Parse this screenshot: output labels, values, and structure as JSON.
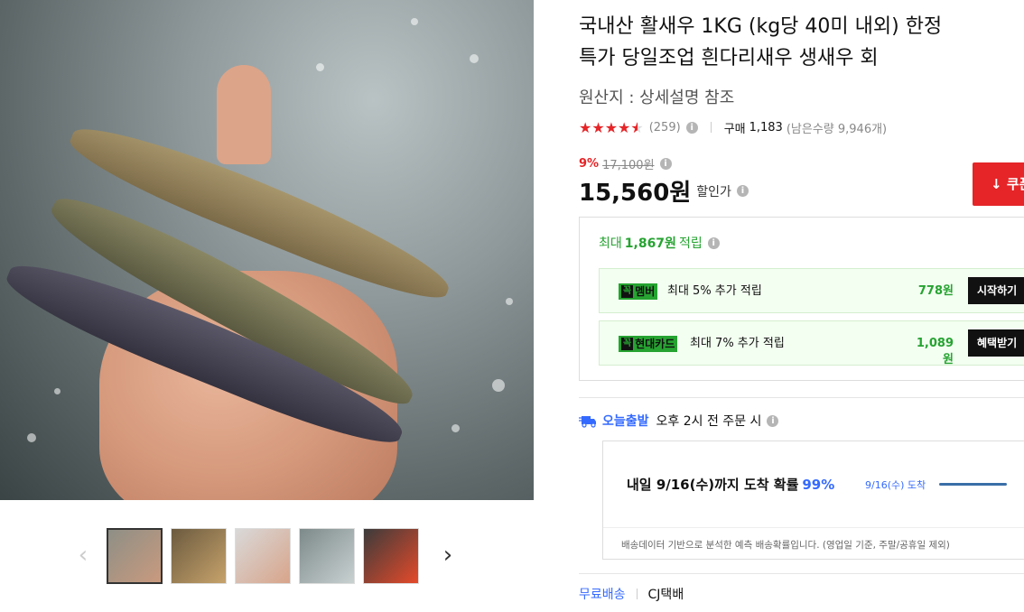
{
  "product": {
    "title_line1": "국내산 활새우 1KG (kg당 40미 내외) 한정",
    "title_line2": "특가 당일조업 흰다리새우 생새우 회",
    "origin": "원산지 : 상세설명 참조"
  },
  "rating": {
    "stars": 4.5,
    "count": "(259)",
    "purchase_label": "구매",
    "purchase_count": "1,183",
    "remaining": "(남은수량 9,946개)"
  },
  "pricing": {
    "discount_rate": "9%",
    "original_price": "17,100원",
    "sale_price": "15,560원",
    "sale_label": "할인가",
    "coupon_button": "쿠폰"
  },
  "rewards": {
    "title_prefix": "최대",
    "title_amount": "1,867원",
    "title_suffix": "적립",
    "items": [
      {
        "badge": "멤버",
        "desc": "최대 5% 추가 적립",
        "amount": "778원",
        "button": "시작하기"
      },
      {
        "badge": "현대카드",
        "desc": "최대 7% 추가 적립",
        "amount": "1,089원",
        "button": "혜택받기"
      }
    ],
    "badge_mark": "꼭"
  },
  "shipping": {
    "today_label": "오늘출발",
    "time_text": "오후 2시 전 주문 시",
    "arrival_text": "내일 9/16(수)까지 도착 확률",
    "arrival_pct": "99%",
    "arrival_date_label": "9/16(수) 도착",
    "arrival_probability": 0.99,
    "note": "배송데이터 기반으로 분석한 예측 배송확률입니다. (영업일 기준, 주말/공휴일 제외)",
    "free_label": "무료배송",
    "carrier": "CJ택배"
  },
  "thumbnails": [
    {
      "name": "thumb-1",
      "colors": [
        "#8e8f86",
        "#c99a7e"
      ]
    },
    {
      "name": "thumb-2",
      "colors": [
        "#6b5a3f",
        "#c7a36b"
      ]
    },
    {
      "name": "thumb-3",
      "colors": [
        "#d9d9d9",
        "#d8a48a"
      ]
    },
    {
      "name": "thumb-4",
      "colors": [
        "#7d8a8a",
        "#c9d1d1"
      ]
    },
    {
      "name": "thumb-5",
      "colors": [
        "#3b3b3b",
        "#e54a2a"
      ]
    }
  ],
  "colors": {
    "accent_red": "#e52528",
    "accent_green": "#26a331",
    "accent_blue": "#346aff"
  }
}
